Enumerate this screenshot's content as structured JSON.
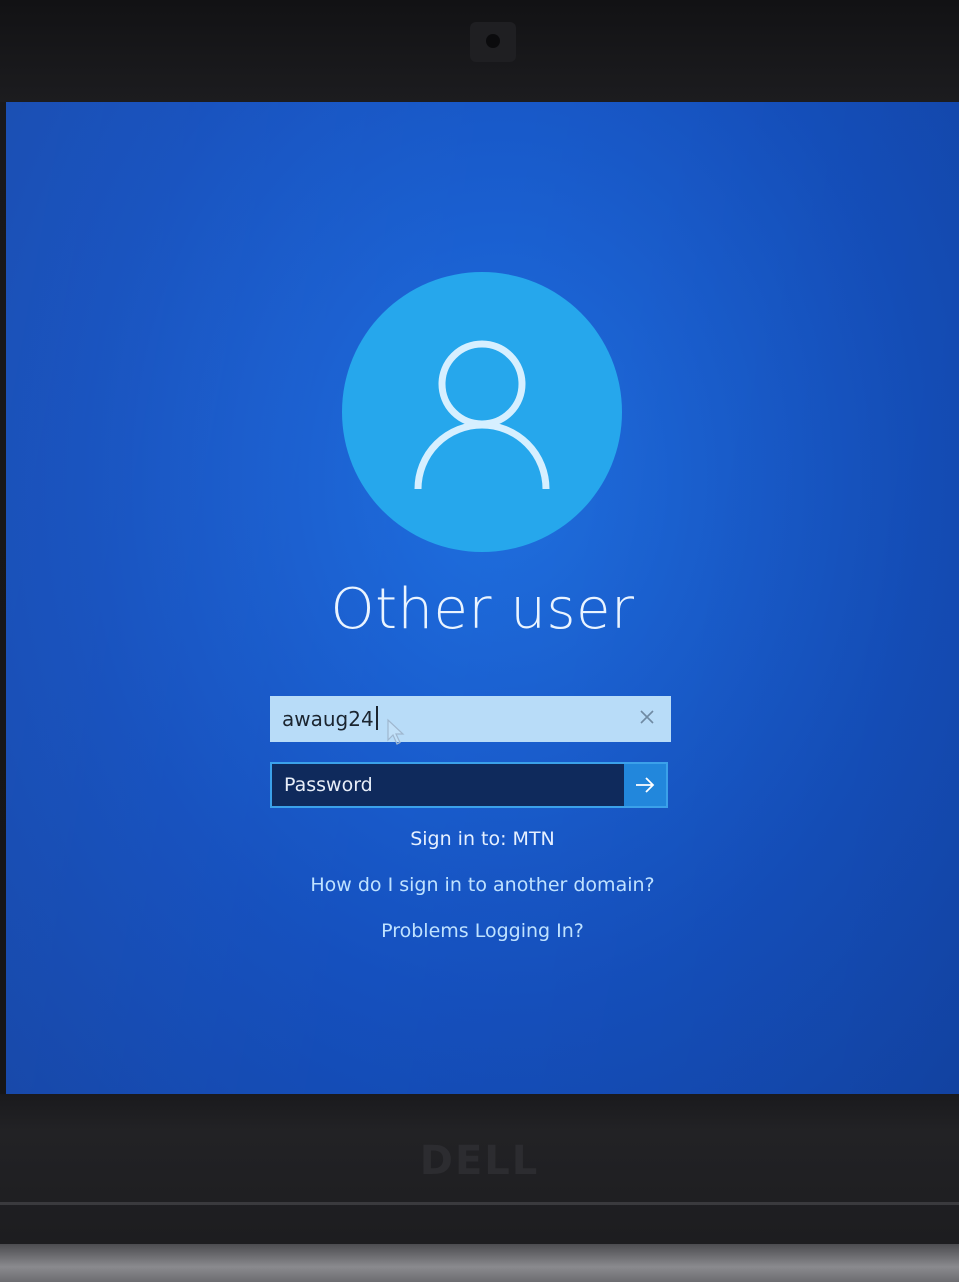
{
  "login": {
    "user_name": "Other user",
    "username_value": "awaug24",
    "password_placeholder": "Password",
    "sign_in_to": "Sign in to: MTN",
    "domain_link": "How do I sign in to another domain?",
    "problems_link": "Problems Logging In?"
  },
  "device": {
    "brand": "DELL"
  },
  "icons": {
    "avatar": "user-silhouette-icon",
    "clear": "close-icon",
    "submit": "arrow-right-icon",
    "pointer": "mouse-pointer-icon"
  },
  "colors": {
    "background": "#1a5fd0",
    "avatar_circle": "#26a7ec",
    "username_field": "#b8dcf8",
    "password_border": "#3ba1ea",
    "submit_button": "#2287dc",
    "link": "#bfe2ff"
  }
}
